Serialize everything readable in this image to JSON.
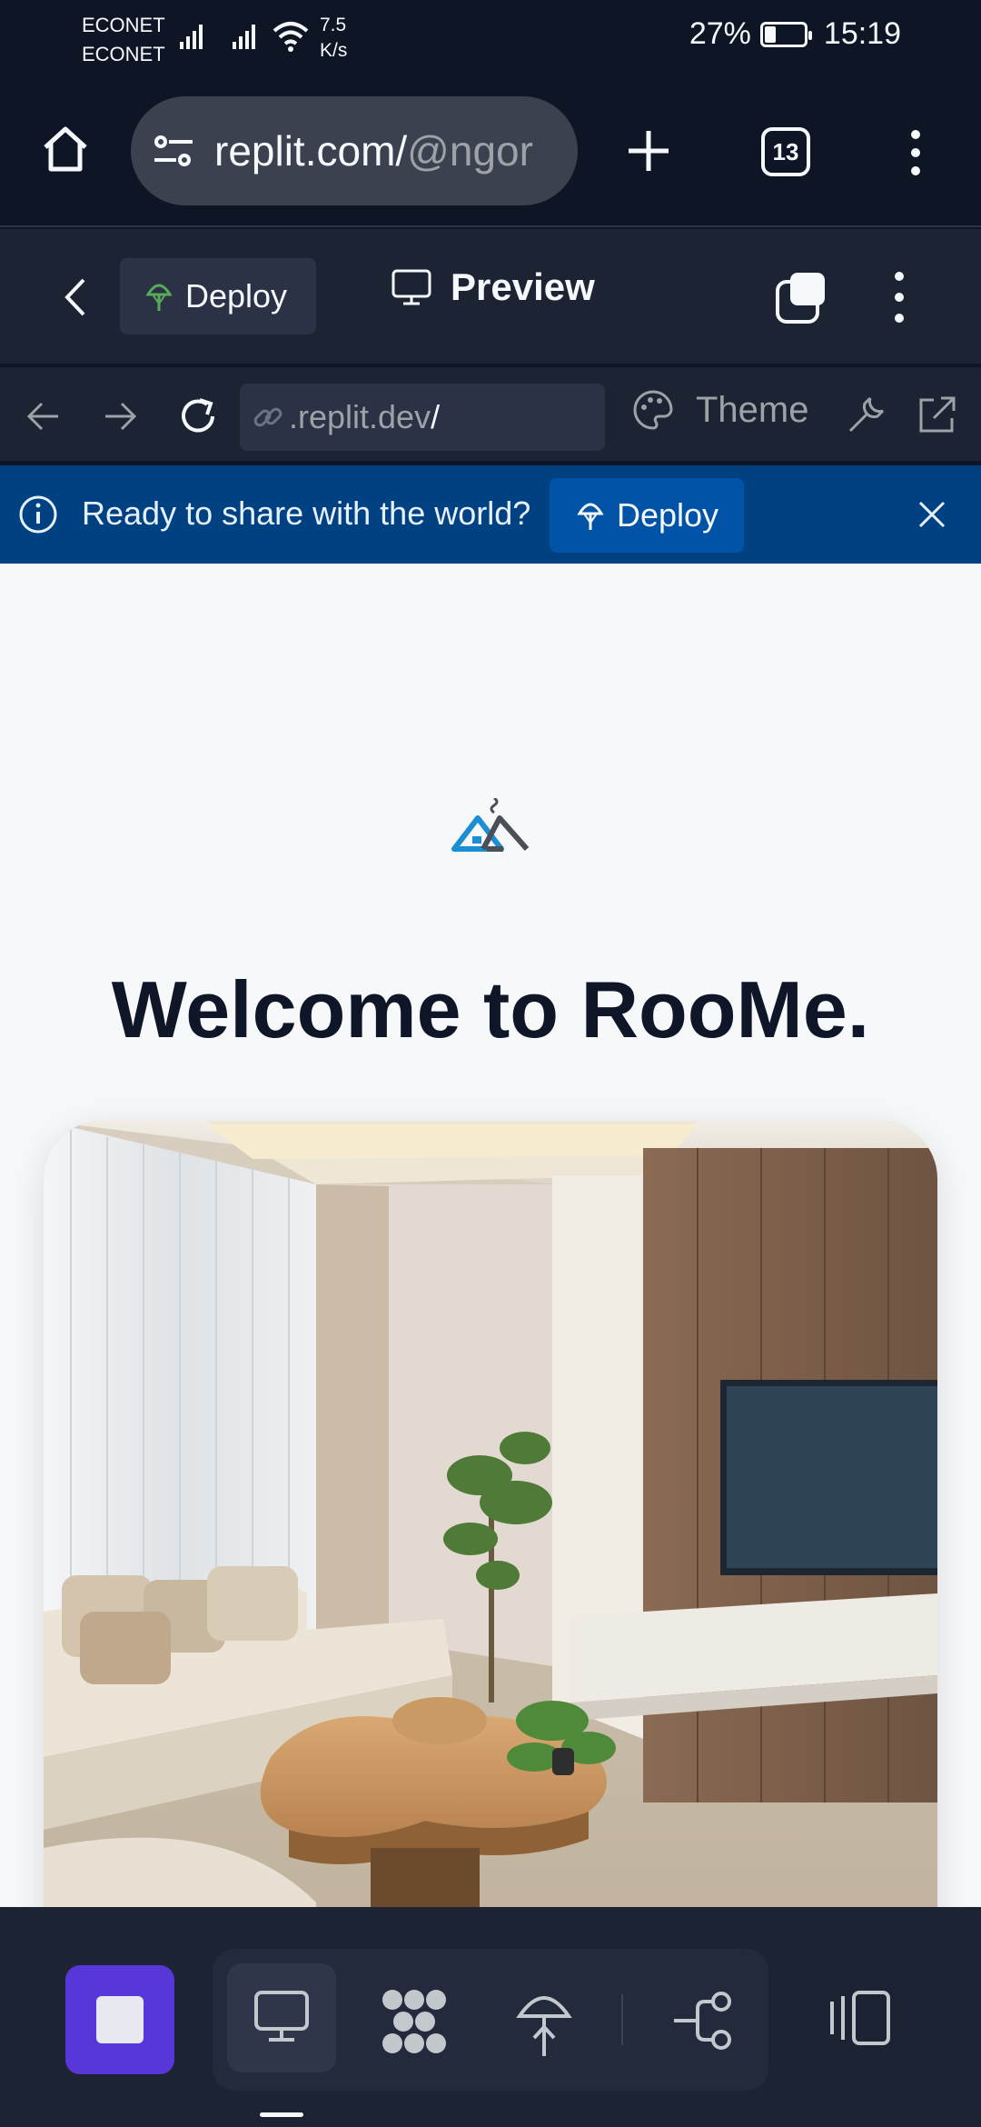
{
  "status_bar": {
    "carriers": [
      "ECONET",
      "ECONET"
    ],
    "net_speed": [
      "7.5",
      "K/s"
    ],
    "battery": "27%",
    "time": "15:19"
  },
  "browser": {
    "url_host": "replit.com/",
    "url_path": "@ngor",
    "tab_count": "13"
  },
  "replit_bar": {
    "deploy_label": "Deploy",
    "preview_label": "Preview"
  },
  "webview_bar": {
    "address": ".replit.dev",
    "address_path": "/",
    "theme_label": "Theme"
  },
  "banner": {
    "message": "Ready to share with the world?",
    "deploy_label": "Deploy"
  },
  "page": {
    "heading": "Welcome to RooMe."
  },
  "colors": {
    "background": "#0e1525",
    "toolbar": "#1c2333",
    "banner": "#004182",
    "accent": "#5837d8",
    "heading": "#0f1628"
  },
  "icons": [
    "home-icon",
    "site-settings-icon",
    "new-tab-icon",
    "tabs-icon",
    "kebab-menu-icon",
    "back-chevron-icon",
    "deploy-icon",
    "monitor-icon",
    "new-window-icon",
    "arrow-left-icon",
    "arrow-right-icon",
    "reload-icon",
    "link-icon",
    "palette-icon",
    "wrench-icon",
    "external-link-icon",
    "info-icon",
    "close-icon",
    "stop-icon",
    "preview-icon",
    "extensions-icon",
    "deployments-icon",
    "git-icon",
    "sidebar-icon"
  ]
}
